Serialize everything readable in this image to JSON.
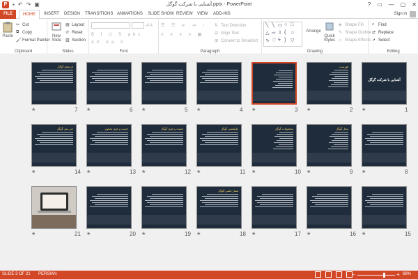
{
  "titlebar": {
    "app_icon": "powerpoint-icon",
    "doc_title": "آشنایی با شرکت گوگل.pptx - PowerPoint",
    "window_buttons": [
      "?",
      "▭",
      "—",
      "▢",
      "✕"
    ]
  },
  "tabs": [
    {
      "label": "FILE",
      "kind": "file"
    },
    {
      "label": "HOME",
      "kind": "active"
    },
    {
      "label": "INSERT"
    },
    {
      "label": "DESIGN"
    },
    {
      "label": "TRANSITIONS"
    },
    {
      "label": "ANIMATIONS"
    },
    {
      "label": "SLIDE SHOW"
    },
    {
      "label": "REVIEW"
    },
    {
      "label": "VIEW"
    },
    {
      "label": "ADD-INS"
    }
  ],
  "signin": "Sign in",
  "ribbon": {
    "clipboard": {
      "paste": "Paste",
      "cut": "Cut",
      "copy": "Copy",
      "format_painter": "Format Painter",
      "label": "Clipboard"
    },
    "slides": {
      "new_slide": "New Slide",
      "layout": "Layout",
      "reset": "Reset",
      "section": "Section",
      "label": "Slides"
    },
    "font": {
      "label": "Font"
    },
    "paragraph": {
      "text_direction": "Text Direction",
      "align_text": "Align Text",
      "convert_smartart": "Convert to SmartArt",
      "label": "Paragraph"
    },
    "drawing": {
      "arrange": "Arrange",
      "quick_styles": "Quick Styles",
      "shape_fill": "Shape Fill",
      "shape_outline": "Shape Outline",
      "shape_effects": "Shape Effects",
      "label": "Drawing"
    },
    "editing": {
      "find": "Find",
      "replace": "Replace",
      "select": "Select",
      "label": "Editing"
    }
  },
  "slides": [
    {
      "num": "1",
      "title": "آشنایی با شرکت گوگل",
      "kind": "title"
    },
    {
      "num": "2",
      "title": "فهرست",
      "kind": "list"
    },
    {
      "num": "3",
      "title": "",
      "kind": "list",
      "selected": true
    },
    {
      "num": "4",
      "title": "",
      "kind": "text"
    },
    {
      "num": "5",
      "title": "",
      "kind": "text"
    },
    {
      "num": "6",
      "title": "",
      "kind": "text"
    },
    {
      "num": "7",
      "title": "تاریخچه گوگل",
      "kind": "text"
    },
    {
      "num": "8",
      "title": "",
      "kind": "text"
    },
    {
      "num": "9",
      "title": "محل گوگل",
      "kind": "list"
    },
    {
      "num": "10",
      "title": "محصولات گوگل",
      "kind": "list"
    },
    {
      "num": "11",
      "title": "اپلیکیشن گوگل",
      "kind": "text"
    },
    {
      "num": "12",
      "title": "جست و جوی گوگل",
      "kind": "text"
    },
    {
      "num": "13",
      "title": "جست و جوی تصاویر",
      "kind": "text"
    },
    {
      "num": "14",
      "title": "جی میل گوگل",
      "kind": "text"
    },
    {
      "num": "15",
      "title": "",
      "kind": "text"
    },
    {
      "num": "16",
      "title": "",
      "kind": "text"
    },
    {
      "num": "17",
      "title": "",
      "kind": "text"
    },
    {
      "num": "18",
      "title": "شعار اصلی گوگل",
      "kind": "text"
    },
    {
      "num": "19",
      "title": "",
      "kind": "text"
    },
    {
      "num": "20",
      "title": "",
      "kind": "text"
    },
    {
      "num": "21",
      "title": "",
      "kind": "photo"
    }
  ],
  "status": {
    "slide": "SLIDE 3 OF 21",
    "language": "PERSIAN",
    "zoom": "68%",
    "zoom_level": 0.68
  },
  "colors": {
    "accent": "#d24726",
    "slide_bg": "#1e2c3b",
    "title_color": "#ffd66b"
  }
}
